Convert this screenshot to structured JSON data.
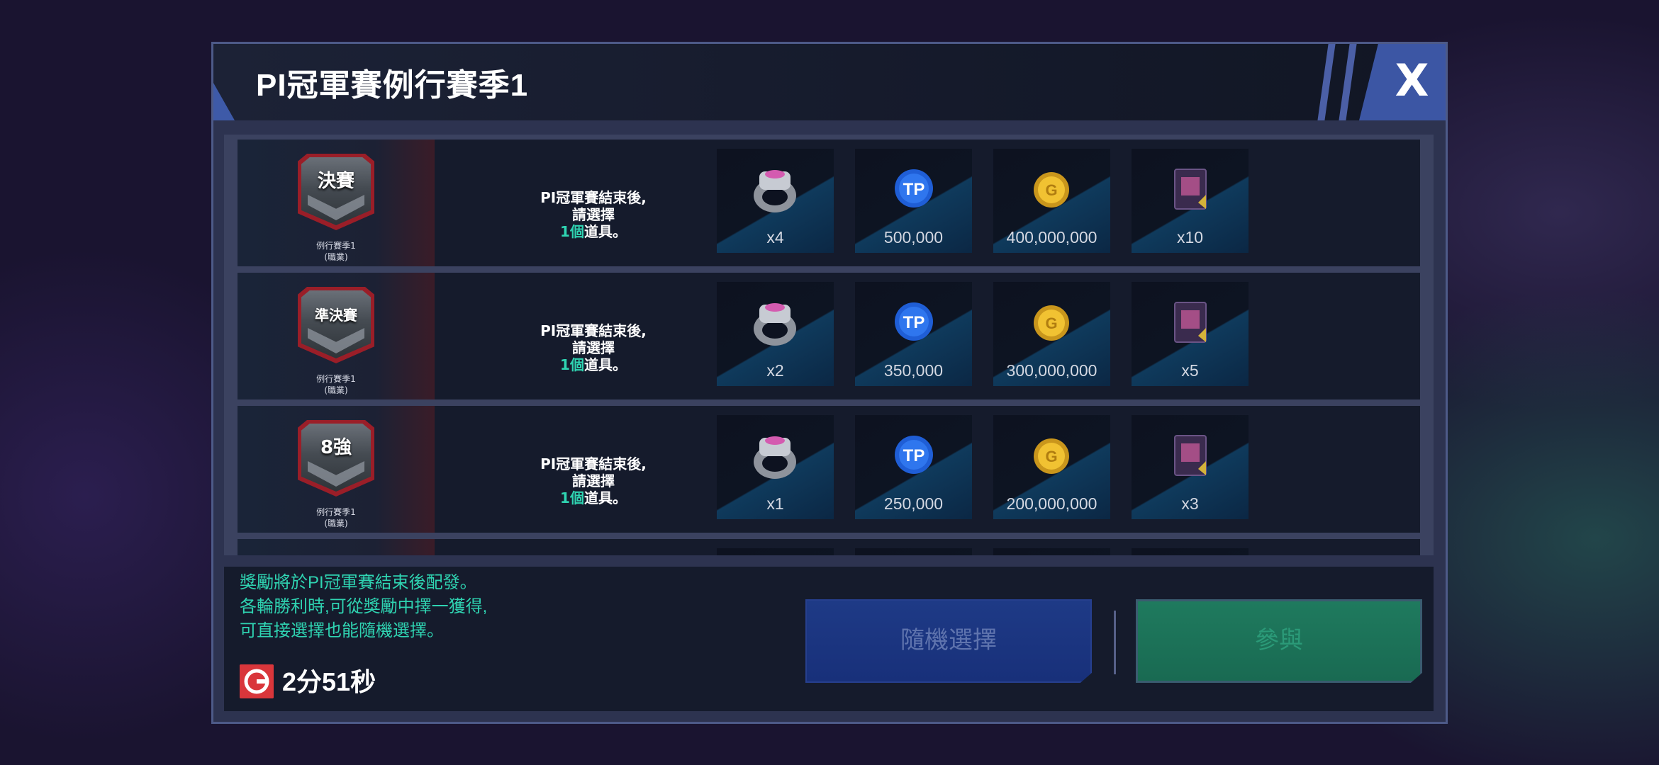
{
  "dialog": {
    "title": "PI冠軍賽例行賽季1",
    "close_label": "X"
  },
  "rows": [
    {
      "badge_label": "決賽",
      "badge_caption_line1": "例行賽季1",
      "badge_caption_line2": "(職業)",
      "desc_line1": "PI冠軍賽結束後,",
      "desc_line2": "請選擇",
      "desc_highlight": "1個",
      "desc_suffix": "道具。",
      "rewards": [
        {
          "icon": "ring-icon",
          "count": "x4"
        },
        {
          "icon": "tp-icon",
          "count": "500,000"
        },
        {
          "icon": "coin-icon",
          "count": "400,000,000"
        },
        {
          "icon": "card-icon",
          "count": "x10"
        }
      ]
    },
    {
      "badge_label": "準決賽",
      "badge_caption_line1": "例行賽季1",
      "badge_caption_line2": "(職業)",
      "desc_line1": "PI冠軍賽結束後,",
      "desc_line2": "請選擇",
      "desc_highlight": "1個",
      "desc_suffix": "道具。",
      "rewards": [
        {
          "icon": "ring-icon",
          "count": "x2"
        },
        {
          "icon": "tp-icon",
          "count": "350,000"
        },
        {
          "icon": "coin-icon",
          "count": "300,000,000"
        },
        {
          "icon": "card-icon",
          "count": "x5"
        }
      ]
    },
    {
      "badge_label": "8強",
      "badge_caption_line1": "例行賽季1",
      "badge_caption_line2": "(職業)",
      "desc_line1": "PI冠軍賽結束後,",
      "desc_line2": "請選擇",
      "desc_highlight": "1個",
      "desc_suffix": "道具。",
      "rewards": [
        {
          "icon": "ring-icon",
          "count": "x1"
        },
        {
          "icon": "tp-icon",
          "count": "250,000"
        },
        {
          "icon": "coin-icon",
          "count": "200,000,000"
        },
        {
          "icon": "card-icon",
          "count": "x3"
        }
      ]
    }
  ],
  "footer": {
    "notice_line1": "獎勵將於PI冠軍賽結束後配發。",
    "notice_line2": "各輪勝利時,可從獎勵中擇一獲得,",
    "notice_line3": "可直接選擇也能隨機選擇。",
    "timer": "2分51秒",
    "random_button": "隨機選擇",
    "confirm_button": "參與"
  },
  "colors": {
    "accent_green": "#2fd4b2",
    "badge_red": "#9a1e28",
    "random_button_bg": "#1e3a86",
    "confirm_button_bg": "#1f7a5e"
  }
}
